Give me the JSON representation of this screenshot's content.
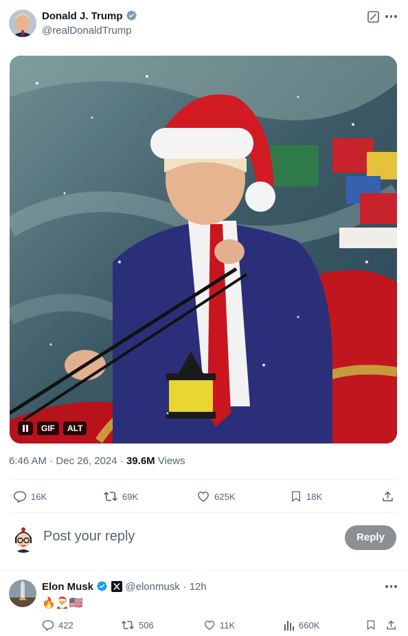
{
  "tweet": {
    "author_name": "Donald J. Trump",
    "author_handle": "@realDonaldTrump",
    "media_badges": {
      "gif": "GIF",
      "alt": "ALT"
    },
    "time": "6:46 AM",
    "date": "Dec 26, 2024",
    "separator": "·",
    "views_count": "39.6M",
    "views_label": "Views",
    "stats": {
      "replies": "16K",
      "reposts": "69K",
      "likes": "625K",
      "bookmarks": "18K"
    }
  },
  "reply_box": {
    "placeholder": "Post your reply",
    "button_label": "Reply"
  },
  "reply": {
    "author_name": "Elon Musk",
    "author_handle": "@elonmusk",
    "time_ago": "12h",
    "separator": "·",
    "text": "🔥🎅🇺🇸",
    "stats": {
      "replies": "422",
      "reposts": "506",
      "likes": "11K",
      "views": "660K"
    }
  },
  "colors": {
    "verified_blue": "#1d9bf0",
    "secondary_text": "#536471",
    "reply_button_disabled": "#8b9095"
  },
  "icons": [
    "verified-badge-icon",
    "grok-icon",
    "more-icon",
    "pause-icon",
    "reply-icon",
    "repost-icon",
    "like-icon",
    "bookmark-icon",
    "share-icon",
    "views-icon",
    "x-logo-icon"
  ]
}
